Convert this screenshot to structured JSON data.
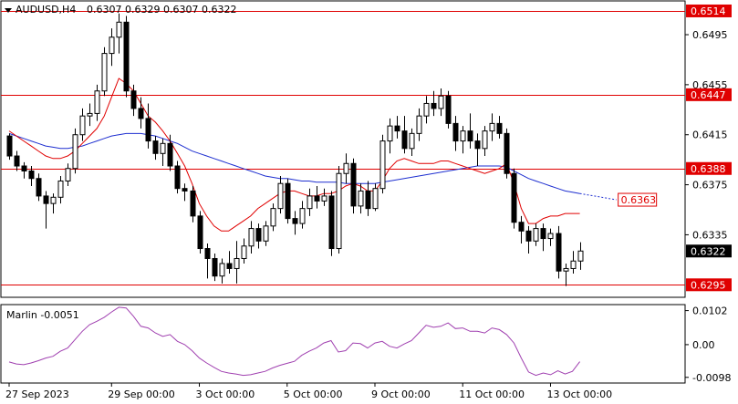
{
  "header": {
    "symbol": "AUDUSD,H4",
    "ohlc": "0.6307 0.6329 0.6307 0.6322"
  },
  "indicator": {
    "label": "Marlin -0.0051"
  },
  "colors": {
    "background": "#ffffff",
    "bull_body": "#ffffff",
    "bear_body": "#000000",
    "candle_border": "#000000",
    "level_lines": "#e00000",
    "red_ma": "#e00000",
    "blue_ma": "#1e2fd0",
    "marlin_line": "#a040b0",
    "current_price_bg": "#000000",
    "current_price_text": "#ffffff",
    "level_label_bg": "#e00000",
    "level_label_text": "#ffffff"
  },
  "chart_data": [
    {
      "type": "candlestick",
      "title": "AUDUSD,H4",
      "ylim": [
        0.6285,
        0.6522
      ],
      "y_ticks": [
        0.6495,
        0.6455,
        0.6415,
        0.6375,
        0.6335
      ],
      "x_ticks": [
        "27 Sep 2023",
        "29 Sep 00:00",
        "3 Oct 00:00",
        "5 Oct 00:00",
        "9 Oct 00:00",
        "11 Oct 00:00",
        "13 Oct 00:00"
      ],
      "current_price": "0.6322",
      "levels": [
        {
          "value": 0.6514,
          "label": "0.6514"
        },
        {
          "value": 0.6447,
          "label": "0.6447"
        },
        {
          "value": 0.6388,
          "label": "0.6388"
        },
        {
          "value": 0.6295,
          "label": "0.6295"
        }
      ],
      "ma_target": {
        "value": 0.6363,
        "label": "0.6363"
      },
      "candles": [
        [
          0.6414,
          0.6416,
          0.6395,
          0.6398
        ],
        [
          0.6398,
          0.6402,
          0.6386,
          0.639
        ],
        [
          0.639,
          0.6393,
          0.638,
          0.6386
        ],
        [
          0.6386,
          0.639,
          0.6374,
          0.638
        ],
        [
          0.638,
          0.6384,
          0.6362,
          0.6366
        ],
        [
          0.6366,
          0.637,
          0.634,
          0.636
        ],
        [
          0.636,
          0.6368,
          0.6352,
          0.6365
        ],
        [
          0.6365,
          0.6382,
          0.636,
          0.6378
        ],
        [
          0.6378,
          0.6392,
          0.6374,
          0.6388
        ],
        [
          0.6388,
          0.642,
          0.6384,
          0.6415
        ],
        [
          0.6415,
          0.6436,
          0.641,
          0.643
        ],
        [
          0.643,
          0.644,
          0.6422,
          0.6432
        ],
        [
          0.6432,
          0.6455,
          0.6426,
          0.645
        ],
        [
          0.645,
          0.6485,
          0.6446,
          0.648
        ],
        [
          0.648,
          0.65,
          0.647,
          0.6493
        ],
        [
          0.6493,
          0.6512,
          0.648,
          0.6505
        ],
        [
          0.6505,
          0.651,
          0.6445,
          0.645
        ],
        [
          0.645,
          0.6455,
          0.643,
          0.6436
        ],
        [
          0.6436,
          0.6445,
          0.642,
          0.6428
        ],
        [
          0.6428,
          0.644,
          0.6404,
          0.641
        ],
        [
          0.641,
          0.6414,
          0.6395,
          0.64
        ],
        [
          0.64,
          0.6412,
          0.639,
          0.6408
        ],
        [
          0.6408,
          0.6415,
          0.6386,
          0.639
        ],
        [
          0.639,
          0.6394,
          0.6368,
          0.6372
        ],
        [
          0.6372,
          0.6376,
          0.6362,
          0.637
        ],
        [
          0.637,
          0.6374,
          0.6345,
          0.635
        ],
        [
          0.635,
          0.6354,
          0.632,
          0.6324
        ],
        [
          0.6324,
          0.6328,
          0.63,
          0.6316
        ],
        [
          0.6316,
          0.632,
          0.6298,
          0.6302
        ],
        [
          0.6302,
          0.6316,
          0.6296,
          0.6312
        ],
        [
          0.6312,
          0.6322,
          0.6304,
          0.6308
        ],
        [
          0.6308,
          0.633,
          0.6296,
          0.6316
        ],
        [
          0.6316,
          0.6332,
          0.6312,
          0.6326
        ],
        [
          0.6326,
          0.6346,
          0.632,
          0.634
        ],
        [
          0.634,
          0.6344,
          0.6324,
          0.633
        ],
        [
          0.633,
          0.6346,
          0.6326,
          0.6342
        ],
        [
          0.6342,
          0.636,
          0.6338,
          0.6356
        ],
        [
          0.6356,
          0.6382,
          0.6352,
          0.6376
        ],
        [
          0.6376,
          0.638,
          0.6344,
          0.6348
        ],
        [
          0.6348,
          0.6354,
          0.6335,
          0.6344
        ],
        [
          0.6344,
          0.6362,
          0.634,
          0.6356
        ],
        [
          0.6356,
          0.6372,
          0.635,
          0.6366
        ],
        [
          0.6366,
          0.6374,
          0.6356,
          0.6362
        ],
        [
          0.6362,
          0.6372,
          0.6358,
          0.6366
        ],
        [
          0.6366,
          0.637,
          0.6318,
          0.6324
        ],
        [
          0.6324,
          0.639,
          0.632,
          0.6384
        ],
        [
          0.6384,
          0.64,
          0.6376,
          0.6392
        ],
        [
          0.6392,
          0.6396,
          0.6352,
          0.6358
        ],
        [
          0.6358,
          0.6376,
          0.6352,
          0.637
        ],
        [
          0.637,
          0.6378,
          0.635,
          0.6356
        ],
        [
          0.6356,
          0.6376,
          0.6354,
          0.6372
        ],
        [
          0.6372,
          0.6415,
          0.6368,
          0.641
        ],
        [
          0.641,
          0.6428,
          0.64,
          0.6422
        ],
        [
          0.6422,
          0.643,
          0.6412,
          0.6418
        ],
        [
          0.6418,
          0.643,
          0.64,
          0.6404
        ],
        [
          0.6404,
          0.642,
          0.6398,
          0.6416
        ],
        [
          0.6416,
          0.6436,
          0.641,
          0.643
        ],
        [
          0.643,
          0.6446,
          0.6424,
          0.644
        ],
        [
          0.644,
          0.645,
          0.643,
          0.6436
        ],
        [
          0.6436,
          0.6452,
          0.643,
          0.6446
        ],
        [
          0.6446,
          0.645,
          0.642,
          0.6424
        ],
        [
          0.6424,
          0.643,
          0.6402,
          0.641
        ],
        [
          0.641,
          0.6422,
          0.64,
          0.6418
        ],
        [
          0.6418,
          0.6432,
          0.6404,
          0.641
        ],
        [
          0.641,
          0.6416,
          0.639,
          0.6404
        ],
        [
          0.6404,
          0.6422,
          0.6398,
          0.6418
        ],
        [
          0.6418,
          0.6432,
          0.641,
          0.6424
        ],
        [
          0.6424,
          0.643,
          0.6412,
          0.6416
        ],
        [
          0.6416,
          0.642,
          0.638,
          0.6384
        ],
        [
          0.6384,
          0.6388,
          0.634,
          0.6345
        ],
        [
          0.6345,
          0.635,
          0.6328,
          0.6338
        ],
        [
          0.6338,
          0.6342,
          0.632,
          0.633
        ],
        [
          0.633,
          0.6344,
          0.6326,
          0.634
        ],
        [
          0.634,
          0.6344,
          0.6322,
          0.6332
        ],
        [
          0.6332,
          0.634,
          0.6326,
          0.6336
        ],
        [
          0.6336,
          0.6342,
          0.63,
          0.6306
        ],
        [
          0.6306,
          0.6312,
          0.6294,
          0.6308
        ],
        [
          0.6308,
          0.6322,
          0.6304,
          0.6314
        ],
        [
          0.6314,
          0.6329,
          0.6307,
          0.6322
        ]
      ],
      "ma_red": [
        0.6418,
        0.6414,
        0.641,
        0.6406,
        0.6402,
        0.6398,
        0.6396,
        0.6396,
        0.6398,
        0.6402,
        0.6408,
        0.6414,
        0.642,
        0.643,
        0.6445,
        0.646,
        0.6456,
        0.645,
        0.644,
        0.643,
        0.6425,
        0.6418,
        0.641,
        0.64,
        0.639,
        0.6376,
        0.636,
        0.635,
        0.6342,
        0.6338,
        0.6338,
        0.6342,
        0.6346,
        0.635,
        0.6356,
        0.636,
        0.6364,
        0.6368,
        0.637,
        0.637,
        0.6368,
        0.6366,
        0.6366,
        0.6368,
        0.6368,
        0.637,
        0.6374,
        0.6376,
        0.6374,
        0.637,
        0.637,
        0.6378,
        0.6388,
        0.6394,
        0.6396,
        0.6394,
        0.6392,
        0.6392,
        0.6392,
        0.6394,
        0.6394,
        0.6392,
        0.639,
        0.6388,
        0.6386,
        0.6384,
        0.6386,
        0.6388,
        0.6392,
        0.6376,
        0.6356,
        0.6344,
        0.6344,
        0.6348,
        0.635,
        0.635,
        0.6352,
        0.6352,
        0.6352
      ],
      "ma_blue": [
        0.6416,
        0.6414,
        0.6412,
        0.641,
        0.6408,
        0.6406,
        0.6405,
        0.6404,
        0.6404,
        0.6405,
        0.6406,
        0.6408,
        0.641,
        0.6412,
        0.6414,
        0.6415,
        0.6416,
        0.6416,
        0.6416,
        0.6415,
        0.6414,
        0.6412,
        0.641,
        0.6408,
        0.6405,
        0.6402,
        0.64,
        0.6398,
        0.6396,
        0.6394,
        0.6392,
        0.639,
        0.6388,
        0.6386,
        0.6384,
        0.6382,
        0.6381,
        0.638,
        0.638,
        0.6379,
        0.6378,
        0.6378,
        0.6377,
        0.6377,
        0.6377,
        0.6377,
        0.6376,
        0.6376,
        0.6376,
        0.6376,
        0.6376,
        0.6377,
        0.6378,
        0.6379,
        0.638,
        0.6381,
        0.6382,
        0.6383,
        0.6384,
        0.6385,
        0.6386,
        0.6387,
        0.6388,
        0.6389,
        0.639,
        0.639,
        0.639,
        0.639,
        0.6389,
        0.6386,
        0.6383,
        0.638,
        0.6378,
        0.6376,
        0.6374,
        0.6372,
        0.637,
        0.6369,
        0.6368
      ],
      "ma_blue_projection": [
        0.6368,
        0.6367,
        0.6366,
        0.6365,
        0.6364,
        0.6363
      ]
    },
    {
      "type": "line",
      "title": "Marlin -0.0051",
      "ylim": [
        -0.0115,
        0.012
      ],
      "y_ticks": [
        0.0102,
        0.0,
        -0.0098
      ],
      "y_tick_labels": [
        "0.0102",
        "0.00",
        "-0.0098"
      ],
      "values": [
        -0.0052,
        -0.0058,
        -0.006,
        -0.0055,
        -0.0048,
        -0.004,
        -0.0035,
        -0.002,
        -0.001,
        0.0015,
        0.004,
        0.006,
        0.007,
        0.0082,
        0.0098,
        0.0112,
        0.011,
        0.0085,
        0.0055,
        0.005,
        0.0035,
        0.0025,
        0.003,
        0.001,
        0.0,
        -0.0018,
        -0.004,
        -0.0055,
        -0.0068,
        -0.008,
        -0.0085,
        -0.0088,
        -0.0092,
        -0.009,
        -0.0085,
        -0.008,
        -0.007,
        -0.0062,
        -0.0056,
        -0.005,
        -0.0032,
        -0.002,
        -0.001,
        0.0005,
        0.0012,
        -0.0022,
        -0.0018,
        0.0005,
        0.0003,
        -0.001,
        0.0005,
        0.001,
        -0.0005,
        -0.001,
        0.0002,
        0.0012,
        0.0035,
        0.0058,
        0.0052,
        0.0055,
        0.0065,
        0.0048,
        0.005,
        0.004,
        0.004,
        0.0035,
        0.005,
        0.0045,
        0.003,
        0.0005,
        -0.004,
        -0.0082,
        -0.0092,
        -0.0085,
        -0.009,
        -0.0078,
        -0.0088,
        -0.008,
        -0.0051
      ]
    }
  ]
}
